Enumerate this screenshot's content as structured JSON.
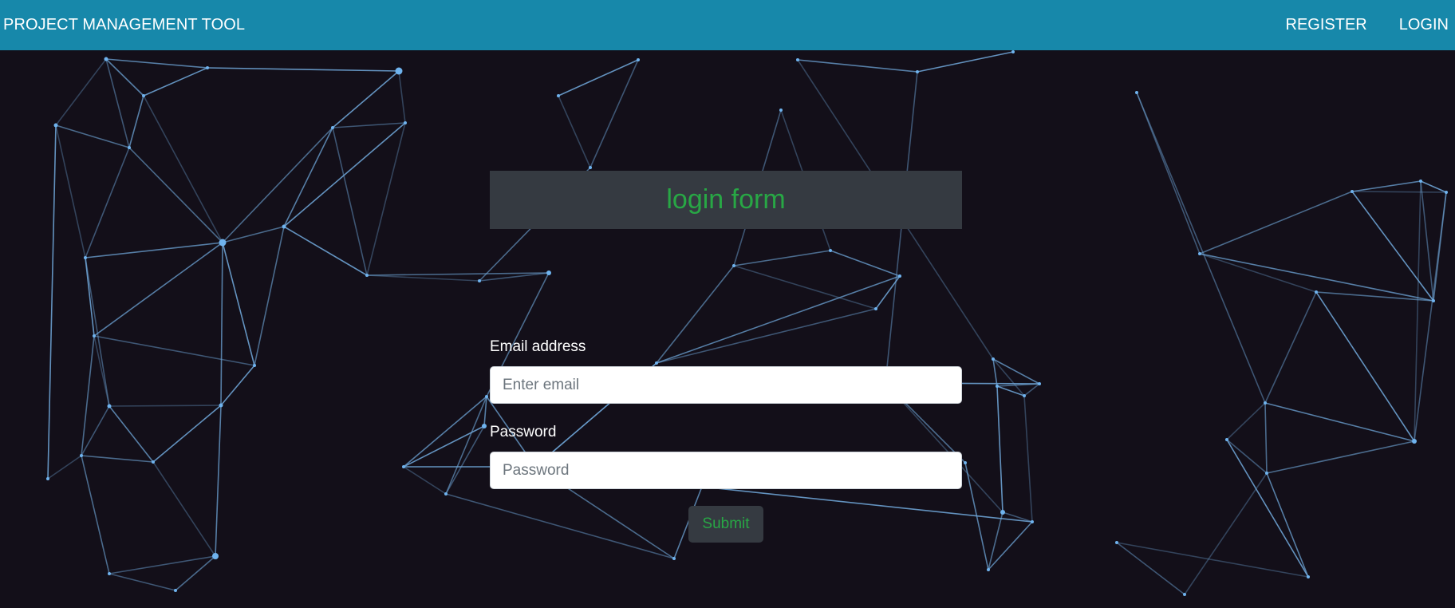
{
  "navbar": {
    "brand": "PROJECT MANAGEMENT TOOL",
    "register_label": "REGISTER",
    "login_label": "LOGIN",
    "background_color": "#1788aa"
  },
  "login_form": {
    "title": "login form",
    "email_label": "Email address",
    "email_placeholder": "Enter email",
    "email_value": "",
    "password_label": "Password",
    "password_placeholder": "Password",
    "password_value": "",
    "submit_label": "Submit",
    "accent_color": "#28a745"
  },
  "background": {
    "style": "particle-network",
    "color": "#130f19",
    "line_color": "#6fa6d8"
  }
}
